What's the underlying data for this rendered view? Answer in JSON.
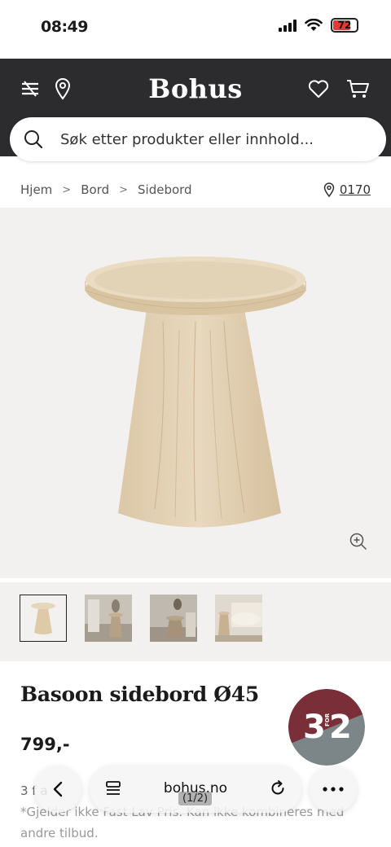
{
  "status_bar": {
    "time": "08:49",
    "battery": "72",
    "battery_color": "#e53935"
  },
  "header": {
    "logo": "Bohus",
    "search_placeholder": "Søk etter produkter eller innhold...",
    "background": "#2c2c2e",
    "icons": [
      "menu-icon",
      "location-pin-icon",
      "heart-icon",
      "cart-icon",
      "search-icon"
    ]
  },
  "breadcrumb": {
    "items": [
      "Hjem",
      "Bord",
      "Sidebord"
    ],
    "zip": "0170"
  },
  "gallery": {
    "thumbnail_count": 4,
    "active_index": 0,
    "background": "#f3f1ef"
  },
  "product": {
    "title": "Basoon sidebord Ø45",
    "price": "799,-",
    "promo_badge": {
      "big_left": "3",
      "small": "FOR",
      "big_right": "2",
      "color_top": "#7a2e38",
      "color_bottom": "#7c8587"
    },
    "info_line1": "3 f       a",
    "info_line2": "*Gjelder ikke Fast Lav Pris. Kan ikke kombineres med",
    "info_line3": "andre tilbud."
  },
  "browser_toolbar": {
    "url": "bohus.no",
    "page_indicator": "(1/2)"
  }
}
